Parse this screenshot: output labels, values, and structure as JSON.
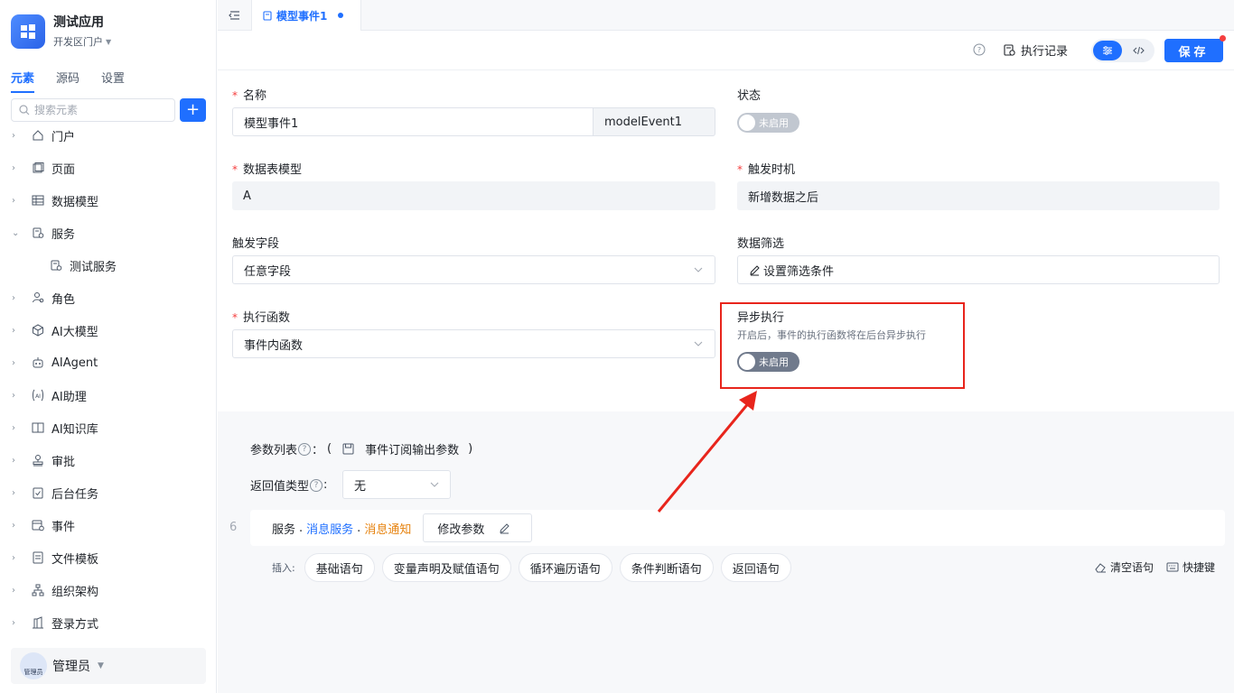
{
  "app": {
    "name": "测试应用",
    "portal": "开发区门户"
  },
  "left_tabs": [
    "元素",
    "源码",
    "设置"
  ],
  "search": {
    "placeholder": "搜索元素",
    "add_label": "+"
  },
  "tree": [
    {
      "label": "门户",
      "icon": "home-icon",
      "expanded": false
    },
    {
      "label": "页面",
      "icon": "page-icon",
      "expanded": false
    },
    {
      "label": "数据模型",
      "icon": "table-icon",
      "expanded": false
    },
    {
      "label": "服务",
      "icon": "service-icon",
      "expanded": true
    },
    {
      "label": "测试服务",
      "icon": "service-icon",
      "child": true
    },
    {
      "label": "角色",
      "icon": "role-icon",
      "expanded": false
    },
    {
      "label": "AI大模型",
      "icon": "cube-icon",
      "expanded": false
    },
    {
      "label": "AIAgent",
      "icon": "robot-icon",
      "expanded": false
    },
    {
      "label": "AI助理",
      "icon": "ai-assistant-icon",
      "expanded": false
    },
    {
      "label": "AI知识库",
      "icon": "book-icon",
      "expanded": false
    },
    {
      "label": "审批",
      "icon": "stamp-icon",
      "expanded": false
    },
    {
      "label": "后台任务",
      "icon": "task-icon",
      "expanded": false
    },
    {
      "label": "事件",
      "icon": "event-icon",
      "expanded": false
    },
    {
      "label": "文件模板",
      "icon": "file-icon",
      "expanded": false
    },
    {
      "label": "组织架构",
      "icon": "org-icon",
      "expanded": false
    },
    {
      "label": "登录方式",
      "icon": "login-icon",
      "expanded": false
    }
  ],
  "user": {
    "name": "管理员",
    "avatar_text": "管理员"
  },
  "doc_tab": {
    "label": "模型事件1"
  },
  "toolbar": {
    "history_label": "执行记录",
    "save_label": "保存"
  },
  "form": {
    "name_label": "名称",
    "name_value": "模型事件1",
    "name_code": "modelEvent1",
    "status_label": "状态",
    "status_toggle": "未启用",
    "table_label": "数据表模型",
    "table_value": "A",
    "trigger_time_label": "触发时机",
    "trigger_time_value": "新增数据之后",
    "trigger_field_label": "触发字段",
    "trigger_field_value": "任意字段",
    "filter_label": "数据筛选",
    "filter_value": "设置筛选条件",
    "func_label": "执行函数",
    "func_value": "事件内函数",
    "async_label": "异步执行",
    "async_hint": "开启后，事件的执行函数将在后台异步执行",
    "async_toggle": "未启用"
  },
  "params": {
    "label": "参数列表",
    "colon": "：",
    "open_paren": "(",
    "value": "事件订阅输出参数",
    "close_paren": ")",
    "return_label": "返回值类型",
    "return_value": "无"
  },
  "code": {
    "line_no": "6",
    "part1": "服务",
    "dot1": ".",
    "part2": "消息服务",
    "dot2": ".",
    "part3": "消息通知",
    "modify_label": "修改参数"
  },
  "insert": {
    "label": "插入:",
    "buttons": [
      "基础语句",
      "变量声明及赋值语句",
      "循环遍历语句",
      "条件判断语句",
      "返回语句"
    ],
    "clear_label": "清空语句",
    "shortcut_label": "快捷键"
  },
  "colors": {
    "accent": "#1f6fff",
    "highlight": "#e8251c",
    "orange": "#e6820e"
  }
}
